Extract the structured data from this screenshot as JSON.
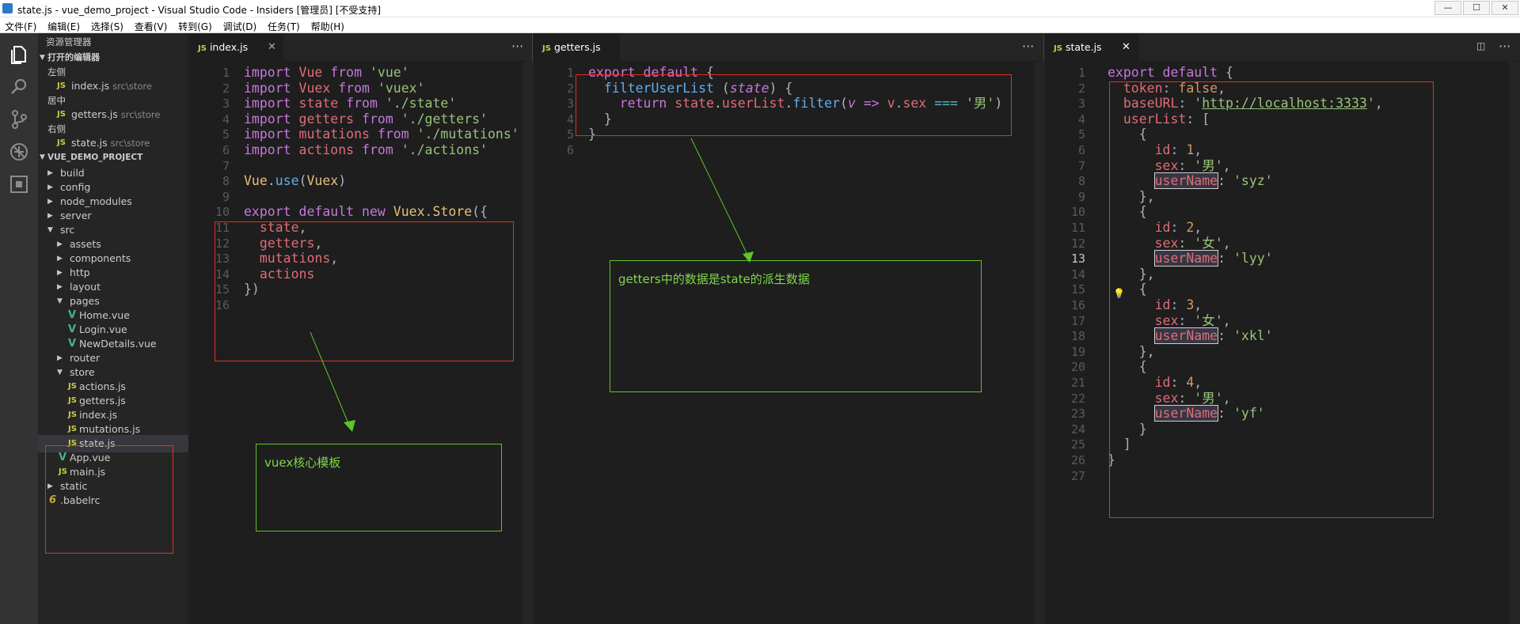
{
  "window": {
    "title": "state.js - vue_demo_project - Visual Studio Code - Insiders [管理员] [不受支持]",
    "controls": [
      "—",
      "☐",
      "✕"
    ]
  },
  "menu": [
    "文件(F)",
    "编辑(E)",
    "选择(S)",
    "查看(V)",
    "转到(G)",
    "调试(D)",
    "任务(T)",
    "帮助(H)"
  ],
  "activity": [
    "files-icon",
    "search-icon",
    "source-control-icon",
    "debug-icon",
    "extensions-icon"
  ],
  "explorer": {
    "title": "资源管理器",
    "open_editors": {
      "label": "打开的编辑器",
      "groups": [
        {
          "name": "左侧",
          "file": "index.js",
          "path": "src\\store"
        },
        {
          "name": "居中",
          "file": "getters.js",
          "path": "src\\store"
        },
        {
          "name": "右侧",
          "file": "state.js",
          "path": "src\\store"
        }
      ]
    },
    "project": "VUE_DEMO_PROJECT",
    "tree": [
      {
        "label": "build",
        "type": "folder",
        "depth": 0
      },
      {
        "label": "config",
        "type": "folder",
        "depth": 0
      },
      {
        "label": "node_modules",
        "type": "folder",
        "depth": 0
      },
      {
        "label": "server",
        "type": "folder",
        "depth": 0
      },
      {
        "label": "src",
        "type": "folder-open",
        "depth": 0
      },
      {
        "label": "assets",
        "type": "folder",
        "depth": 1
      },
      {
        "label": "components",
        "type": "folder",
        "depth": 1
      },
      {
        "label": "http",
        "type": "folder",
        "depth": 1
      },
      {
        "label": "layout",
        "type": "folder",
        "depth": 1
      },
      {
        "label": "pages",
        "type": "folder-open",
        "depth": 1
      },
      {
        "label": "Home.vue",
        "type": "vue",
        "depth": 2
      },
      {
        "label": "Login.vue",
        "type": "vue",
        "depth": 2
      },
      {
        "label": "NewDetails.vue",
        "type": "vue",
        "depth": 2
      },
      {
        "label": "router",
        "type": "folder",
        "depth": 1
      },
      {
        "label": "store",
        "type": "folder-open",
        "depth": 1
      },
      {
        "label": "actions.js",
        "type": "js",
        "depth": 2
      },
      {
        "label": "getters.js",
        "type": "js",
        "depth": 2
      },
      {
        "label": "index.js",
        "type": "js",
        "depth": 2
      },
      {
        "label": "mutations.js",
        "type": "js",
        "depth": 2
      },
      {
        "label": "state.js",
        "type": "js",
        "depth": 2,
        "selected": true
      },
      {
        "label": "App.vue",
        "type": "vue",
        "depth": 1
      },
      {
        "label": "main.js",
        "type": "js",
        "depth": 1
      },
      {
        "label": "static",
        "type": "folder",
        "depth": 0
      },
      {
        "label": ".babelrc",
        "type": "babel",
        "depth": 0
      }
    ]
  },
  "editors": [
    {
      "tab": "index.js",
      "more": "···",
      "lines": [
        [
          [
            "import",
            "k"
          ],
          [
            " ",
            ""
          ],
          [
            "Vue",
            "v"
          ],
          [
            " ",
            ""
          ],
          [
            "from",
            "k"
          ],
          [
            " ",
            ""
          ],
          [
            "'vue'",
            "s"
          ]
        ],
        [
          [
            "import",
            "k"
          ],
          [
            " ",
            ""
          ],
          [
            "Vuex",
            "v"
          ],
          [
            " ",
            ""
          ],
          [
            "from",
            "k"
          ],
          [
            " ",
            ""
          ],
          [
            "'vuex'",
            "s"
          ]
        ],
        [
          [
            "import",
            "k"
          ],
          [
            " ",
            ""
          ],
          [
            "state",
            "v"
          ],
          [
            " ",
            ""
          ],
          [
            "from",
            "k"
          ],
          [
            " ",
            ""
          ],
          [
            "'./state'",
            "s"
          ]
        ],
        [
          [
            "import",
            "k"
          ],
          [
            " ",
            ""
          ],
          [
            "getters",
            "v"
          ],
          [
            " ",
            ""
          ],
          [
            "from",
            "k"
          ],
          [
            " ",
            ""
          ],
          [
            "'./getters'",
            "s"
          ]
        ],
        [
          [
            "import",
            "k"
          ],
          [
            " ",
            ""
          ],
          [
            "mutations",
            "v"
          ],
          [
            " ",
            ""
          ],
          [
            "from",
            "k"
          ],
          [
            " ",
            ""
          ],
          [
            "'./mutations'",
            "s"
          ]
        ],
        [
          [
            "import",
            "k"
          ],
          [
            " ",
            ""
          ],
          [
            "actions",
            "v"
          ],
          [
            " ",
            ""
          ],
          [
            "from",
            "k"
          ],
          [
            " ",
            ""
          ],
          [
            "'./actions'",
            "s"
          ]
        ],
        [],
        [
          [
            "Vue",
            "c"
          ],
          [
            ".",
            "p"
          ],
          [
            "use",
            "f"
          ],
          [
            "(",
            "p"
          ],
          [
            "Vuex",
            "c"
          ],
          [
            ")",
            "p"
          ]
        ],
        [],
        [
          [
            "export",
            "k"
          ],
          [
            " ",
            ""
          ],
          [
            "default",
            "k"
          ],
          [
            " ",
            ""
          ],
          [
            "new",
            "k"
          ],
          [
            " ",
            ""
          ],
          [
            "Vuex",
            "c"
          ],
          [
            ".",
            "p"
          ],
          [
            "Store",
            "c"
          ],
          [
            "({",
            "p"
          ]
        ],
        [
          [
            "  ",
            ""
          ],
          [
            "state",
            "v"
          ],
          [
            ",",
            "p"
          ]
        ],
        [
          [
            "  ",
            ""
          ],
          [
            "getters",
            "v"
          ],
          [
            ",",
            "p"
          ]
        ],
        [
          [
            "  ",
            ""
          ],
          [
            "mutations",
            "v"
          ],
          [
            ",",
            "p"
          ]
        ],
        [
          [
            "  ",
            ""
          ],
          [
            "actions",
            "v"
          ]
        ],
        [
          [
            "})",
            "p"
          ]
        ],
        []
      ]
    },
    {
      "tab": "getters.js",
      "more": "···",
      "lines": [
        [
          [
            "export",
            "k"
          ],
          [
            " ",
            ""
          ],
          [
            "default",
            "k"
          ],
          [
            " ",
            ""
          ],
          [
            "{",
            "p"
          ]
        ],
        [
          [
            "  ",
            ""
          ],
          [
            "filterUserList",
            "f"
          ],
          [
            " ",
            ""
          ],
          [
            "(",
            "p"
          ],
          [
            "state",
            "a"
          ],
          [
            ")",
            "p"
          ],
          [
            " ",
            ""
          ],
          [
            "{",
            "p"
          ]
        ],
        [
          [
            "    ",
            ""
          ],
          [
            "return",
            "k"
          ],
          [
            " ",
            ""
          ],
          [
            "state",
            "v"
          ],
          [
            ".",
            "p"
          ],
          [
            "userList",
            "v"
          ],
          [
            ".",
            "p"
          ],
          [
            "filter",
            "f"
          ],
          [
            "(",
            "p"
          ],
          [
            "v",
            "a"
          ],
          [
            " ",
            ""
          ],
          [
            "=>",
            "k"
          ],
          [
            " ",
            ""
          ],
          [
            "v",
            "v"
          ],
          [
            ".",
            "p"
          ],
          [
            "sex",
            "v"
          ],
          [
            " ",
            ""
          ],
          [
            "===",
            "o"
          ],
          [
            " ",
            ""
          ],
          [
            "'男'",
            "s"
          ],
          [
            ")",
            "p"
          ]
        ],
        [
          [
            "  ",
            ""
          ],
          [
            "}",
            "p"
          ]
        ],
        [
          [
            "}",
            "p"
          ]
        ],
        []
      ]
    },
    {
      "tab": "state.js",
      "more": "···",
      "current_line": 13,
      "lines": [
        [
          [
            "export",
            "k"
          ],
          [
            " ",
            ""
          ],
          [
            "default",
            "k"
          ],
          [
            " ",
            ""
          ],
          [
            "{",
            "p"
          ]
        ],
        [
          [
            "  ",
            ""
          ],
          [
            "token",
            "v"
          ],
          [
            ":",
            "p"
          ],
          [
            " ",
            ""
          ],
          [
            "false",
            "n"
          ],
          [
            ",",
            "p"
          ]
        ],
        [
          [
            "  ",
            ""
          ],
          [
            "baseURL",
            "v"
          ],
          [
            ":",
            "p"
          ],
          [
            " ",
            ""
          ],
          [
            "'",
            "s"
          ],
          [
            "http://localhost:3333",
            "s url"
          ],
          [
            "'",
            "s"
          ],
          [
            ",",
            "p"
          ]
        ],
        [
          [
            "  ",
            ""
          ],
          [
            "userList",
            "v"
          ],
          [
            ":",
            "p"
          ],
          [
            " ",
            ""
          ],
          [
            "[",
            "p"
          ]
        ],
        [
          [
            "    ",
            ""
          ],
          [
            "{",
            "p"
          ]
        ],
        [
          [
            "      ",
            ""
          ],
          [
            "id",
            "v"
          ],
          [
            ":",
            "p"
          ],
          [
            " ",
            ""
          ],
          [
            "1",
            "n"
          ],
          [
            ",",
            "p"
          ]
        ],
        [
          [
            "      ",
            ""
          ],
          [
            "sex",
            "v"
          ],
          [
            ":",
            "p"
          ],
          [
            " ",
            ""
          ],
          [
            "'男'",
            "s"
          ],
          [
            ",",
            "p"
          ]
        ],
        [
          [
            "      ",
            ""
          ],
          [
            "userName",
            "v nb"
          ],
          [
            ":",
            "p"
          ],
          [
            " ",
            ""
          ],
          [
            "'syz'",
            "s"
          ]
        ],
        [
          [
            "    ",
            ""
          ],
          [
            "},",
            "p"
          ]
        ],
        [
          [
            "    ",
            ""
          ],
          [
            "{",
            "p"
          ]
        ],
        [
          [
            "      ",
            ""
          ],
          [
            "id",
            "v"
          ],
          [
            ":",
            "p"
          ],
          [
            " ",
            ""
          ],
          [
            "2",
            "n"
          ],
          [
            ",",
            "p"
          ]
        ],
        [
          [
            "      ",
            ""
          ],
          [
            "sex",
            "v"
          ],
          [
            ":",
            "p"
          ],
          [
            " ",
            ""
          ],
          [
            "'女'",
            "s"
          ],
          [
            ",",
            "p"
          ]
        ],
        [
          [
            "      ",
            ""
          ],
          [
            "userName",
            "v nb"
          ],
          [
            ":",
            "p"
          ],
          [
            " ",
            ""
          ],
          [
            "'lyy'",
            "s"
          ]
        ],
        [
          [
            "    ",
            ""
          ],
          [
            "},",
            "p"
          ]
        ],
        [
          [
            "    ",
            ""
          ],
          [
            "{",
            "p"
          ]
        ],
        [
          [
            "      ",
            ""
          ],
          [
            "id",
            "v"
          ],
          [
            ":",
            "p"
          ],
          [
            " ",
            ""
          ],
          [
            "3",
            "n"
          ],
          [
            ",",
            "p"
          ]
        ],
        [
          [
            "      ",
            ""
          ],
          [
            "sex",
            "v"
          ],
          [
            ":",
            "p"
          ],
          [
            " ",
            ""
          ],
          [
            "'女'",
            "s"
          ],
          [
            ",",
            "p"
          ]
        ],
        [
          [
            "      ",
            ""
          ],
          [
            "userName",
            "v nb"
          ],
          [
            ":",
            "p"
          ],
          [
            " ",
            ""
          ],
          [
            "'xkl'",
            "s"
          ]
        ],
        [
          [
            "    ",
            ""
          ],
          [
            "},",
            "p"
          ]
        ],
        [
          [
            "    ",
            ""
          ],
          [
            "{",
            "p"
          ]
        ],
        [
          [
            "      ",
            ""
          ],
          [
            "id",
            "v"
          ],
          [
            ":",
            "p"
          ],
          [
            " ",
            ""
          ],
          [
            "4",
            "n"
          ],
          [
            ",",
            "p"
          ]
        ],
        [
          [
            "      ",
            ""
          ],
          [
            "sex",
            "v"
          ],
          [
            ":",
            "p"
          ],
          [
            " ",
            ""
          ],
          [
            "'男'",
            "s"
          ],
          [
            ",",
            "p"
          ]
        ],
        [
          [
            "      ",
            ""
          ],
          [
            "userName",
            "v nb"
          ],
          [
            ":",
            "p"
          ],
          [
            " ",
            ""
          ],
          [
            "'yf'",
            "s"
          ]
        ],
        [
          [
            "    ",
            ""
          ],
          [
            "}",
            "p"
          ]
        ],
        [
          [
            "  ",
            ""
          ],
          [
            "]",
            "p"
          ]
        ],
        [
          [
            "}",
            "p"
          ]
        ],
        []
      ]
    }
  ],
  "annotations": {
    "getters_note": "getters中的数据是state的派生数据",
    "vuex_note": "vuex核心模板"
  }
}
